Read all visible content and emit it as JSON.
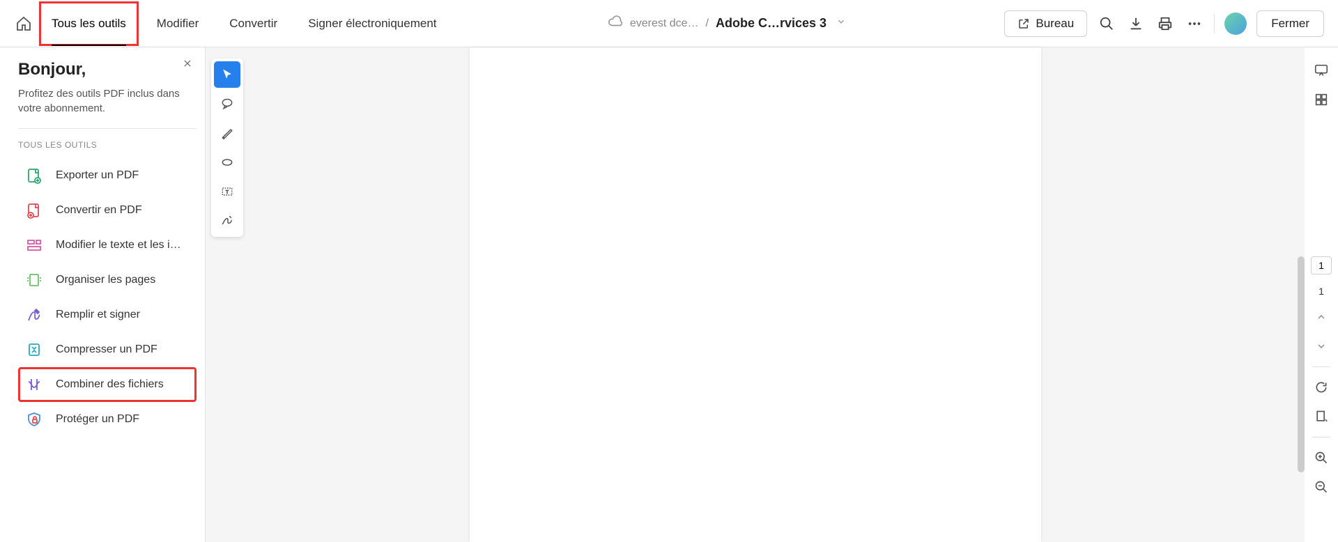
{
  "topbar": {
    "tabs": [
      {
        "label": "Tous les outils"
      },
      {
        "label": "Modifier"
      },
      {
        "label": "Convertir"
      },
      {
        "label": "Signer électroniquement"
      }
    ],
    "cloud_source": "everest dce…",
    "breadcrumb_sep": "/",
    "doc_title": "Adobe C…rvices 3",
    "bureau_label": "Bureau",
    "fermer_label": "Fermer"
  },
  "sidebar": {
    "greeting": "Bonjour,",
    "subtitle": "Profitez des outils PDF inclus dans votre abonnement.",
    "section_label": "TOUS LES OUTILS",
    "tools": [
      {
        "label": "Exporter un PDF"
      },
      {
        "label": "Convertir en PDF"
      },
      {
        "label": "Modifier le texte et les im…"
      },
      {
        "label": "Organiser les pages"
      },
      {
        "label": "Remplir et signer"
      },
      {
        "label": "Compresser un PDF"
      },
      {
        "label": "Combiner des fichiers"
      },
      {
        "label": "Protéger un PDF"
      }
    ]
  },
  "rightbar": {
    "current_page": "1",
    "total_pages": "1"
  }
}
